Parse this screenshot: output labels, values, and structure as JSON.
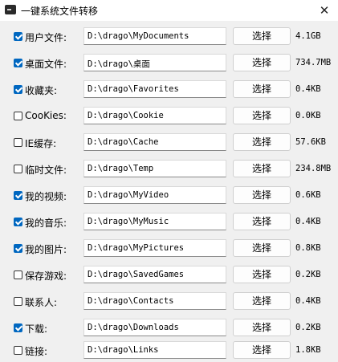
{
  "window": {
    "title": "一键系统文件转移",
    "close_symbol": "✕"
  },
  "rows": [
    {
      "label": "用户文件:",
      "checked": true,
      "path": "D:\\drago\\MyDocuments",
      "button": "选择",
      "size": "4.1GB"
    },
    {
      "label": "桌面文件:",
      "checked": true,
      "path": "D:\\drago\\桌面",
      "button": "选择",
      "size": "734.7MB"
    },
    {
      "label": "收藏夹:",
      "checked": true,
      "path": "D:\\drago\\Favorites",
      "button": "选择",
      "size": "0.4KB"
    },
    {
      "label": "CooKies:",
      "checked": false,
      "path": "D:\\drago\\Cookie",
      "button": "选择",
      "size": "0.0KB"
    },
    {
      "label": "IE缓存:",
      "checked": false,
      "path": "D:\\drago\\Cache",
      "button": "选择",
      "size": "57.6KB"
    },
    {
      "label": "临时文件:",
      "checked": false,
      "path": "D:\\drago\\Temp",
      "button": "选择",
      "size": "234.8MB"
    },
    {
      "label": "我的视频:",
      "checked": true,
      "path": "D:\\drago\\MyVideo",
      "button": "选择",
      "size": "0.6KB"
    },
    {
      "label": "我的音乐:",
      "checked": true,
      "path": "D:\\drago\\MyMusic",
      "button": "选择",
      "size": "0.4KB"
    },
    {
      "label": "我的图片:",
      "checked": true,
      "path": "D:\\drago\\MyPictures",
      "button": "选择",
      "size": "0.8KB"
    },
    {
      "label": "保存游戏:",
      "checked": false,
      "path": "D:\\drago\\SavedGames",
      "button": "选择",
      "size": "0.2KB"
    },
    {
      "label": "联系人:",
      "checked": false,
      "path": "D:\\drago\\Contacts",
      "button": "选择",
      "size": "0.4KB"
    },
    {
      "label": "下载:",
      "checked": true,
      "path": "D:\\drago\\Downloads",
      "button": "选择",
      "size": "0.2KB"
    },
    {
      "label": "链接:",
      "checked": false,
      "path": "D:\\drago\\Links",
      "button": "选择",
      "size": "1.8KB"
    }
  ],
  "colors": {
    "checkbox_checked": "#0067c0",
    "background": "#f0f0f0"
  }
}
